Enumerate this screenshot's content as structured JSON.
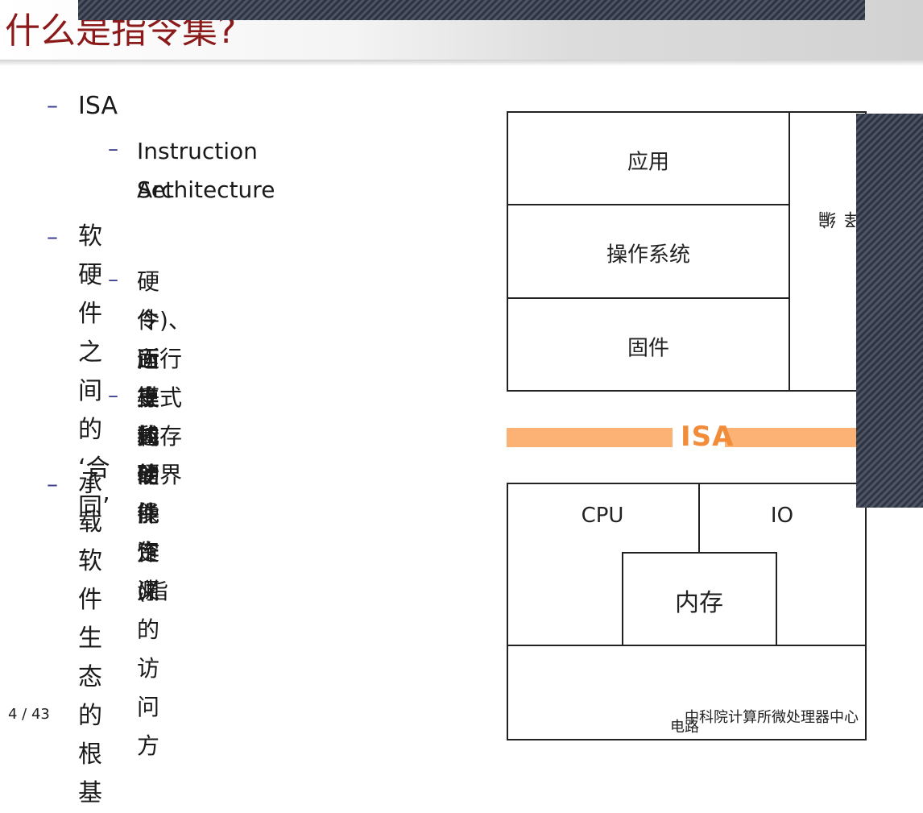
{
  "title": "什么是指令集?",
  "bullets": {
    "isa": "ISA",
    "isa_sub_line1": "Instruction Set",
    "isa_sub_line2": "Architecture",
    "contract": "软硬件之间的 ‘合同’",
    "contract_sub1_line1": "硬件所支持的操作 (指",
    "contract_sub1_line2": "令)、运行模式和存储界",
    "contract_sub1_line3": "面等的功能定义",
    "contract_sub2_line1": "上述硬件资源的访问方",
    "contract_sub2_line2": "式",
    "ecosystem": "承载软件生态的根基",
    "dash": "–"
  },
  "diagram": {
    "app": "应用",
    "os": "操作系统",
    "firmware": "固件",
    "side": "编译器等",
    "isa": "ISA",
    "cpu": "CPU",
    "io": "IO",
    "memory": "内存",
    "bottom_partial": "电路"
  },
  "footer": {
    "page": "4 / 43",
    "org": "中科院计算所微处理器中心"
  },
  "colors": {
    "title": "#8b1a1a",
    "dash": "#3b3b8f",
    "isa_bar": "#fbb274",
    "isa_text": "#f08c3a",
    "overlay": "#2e3442"
  }
}
